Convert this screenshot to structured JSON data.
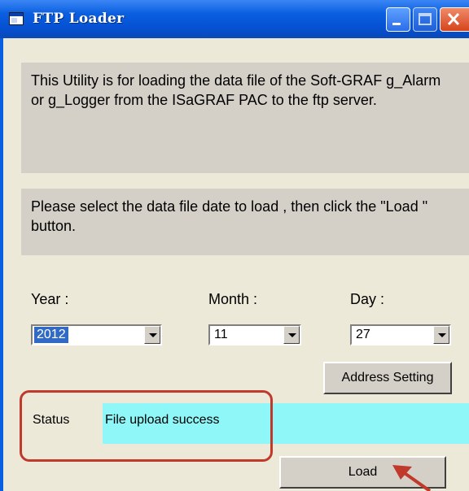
{
  "window": {
    "title": "FTP Loader"
  },
  "info": {
    "description": "This Utility is for loading the data file of the Soft-GRAF g_Alarm or g_Logger from the ISaGRAF PAC to the ftp server.",
    "instruction": "Please select the data file  date to load , then click the \"Load \" button."
  },
  "date_selection": {
    "year_label": "Year :",
    "month_label": "Month :",
    "day_label": "Day :",
    "year_value": "2012",
    "month_value": "11",
    "day_value": "27"
  },
  "buttons": {
    "address_setting": "Address Setting",
    "load": "Load"
  },
  "status": {
    "label": "Status",
    "value": "File upload success"
  },
  "colors": {
    "status_background": "#8ff7f7",
    "highlight_border": "#c0392b",
    "titlebar": "#0a5fe0"
  }
}
